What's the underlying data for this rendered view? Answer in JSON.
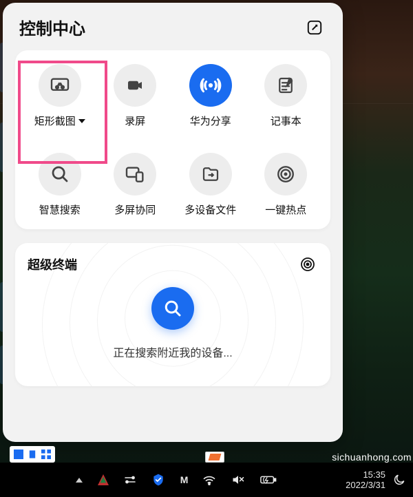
{
  "header": {
    "title": "控制中心"
  },
  "tiles": [
    {
      "name": "screenshot",
      "label": "矩形截图",
      "has_caret": true,
      "active": false
    },
    {
      "name": "record",
      "label": "录屏",
      "has_caret": false,
      "active": false
    },
    {
      "name": "huawei-share",
      "label": "华为分享",
      "has_caret": false,
      "active": true
    },
    {
      "name": "notepad",
      "label": "记事本",
      "has_caret": false,
      "active": false
    },
    {
      "name": "smart-search",
      "label": "智慧搜索",
      "has_caret": false,
      "active": false
    },
    {
      "name": "multi-screen",
      "label": "多屏协同",
      "has_caret": false,
      "active": false
    },
    {
      "name": "multi-device-files",
      "label": "多设备文件",
      "has_caret": false,
      "active": false
    },
    {
      "name": "instant-hotspot",
      "label": "一键热点",
      "has_caret": false,
      "active": false
    }
  ],
  "super_terminal": {
    "title": "超级终端",
    "status": "正在搜索附近我的设备..."
  },
  "taskbar": {
    "time": "15:35",
    "date": "2022/3/31",
    "app_label": "M"
  },
  "watermark": "sichuanhong.com",
  "colors": {
    "accent": "#1a6cf0",
    "highlight": "#f04a8a"
  }
}
